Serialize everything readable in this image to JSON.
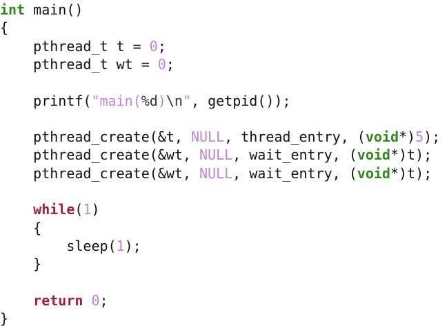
{
  "editor": {
    "lines": [
      [
        {
          "text": "int",
          "cls": "kw"
        },
        {
          "text": " main()",
          "cls": "plain"
        }
      ],
      [
        {
          "text": "{",
          "cls": "plain"
        }
      ],
      [
        {
          "text": "    pthread_t t = ",
          "cls": "plain"
        },
        {
          "text": "0",
          "cls": "lit"
        },
        {
          "text": ";",
          "cls": "plain"
        }
      ],
      [
        {
          "text": "    pthread_t wt = ",
          "cls": "plain"
        },
        {
          "text": "0",
          "cls": "lit"
        },
        {
          "text": ";",
          "cls": "plain"
        }
      ],
      [],
      [
        {
          "text": "    printf(",
          "cls": "plain"
        },
        {
          "text": "\"main(",
          "cls": "lit"
        },
        {
          "text": "%d",
          "cls": "fmt"
        },
        {
          "text": ")",
          "cls": "lit"
        },
        {
          "text": "\\n",
          "cls": "fmt"
        },
        {
          "text": "\"",
          "cls": "lit"
        },
        {
          "text": ", getpid());",
          "cls": "plain"
        }
      ],
      [],
      [
        {
          "text": "    pthread_create(&t, ",
          "cls": "plain"
        },
        {
          "text": "NULL",
          "cls": "lit"
        },
        {
          "text": ", thread_entry, (",
          "cls": "plain"
        },
        {
          "text": "void",
          "cls": "kw"
        },
        {
          "text": "*)",
          "cls": "plain"
        },
        {
          "text": "5",
          "cls": "lit"
        },
        {
          "text": ");",
          "cls": "plain"
        }
      ],
      [
        {
          "text": "    pthread_create(&wt, ",
          "cls": "plain"
        },
        {
          "text": "NULL",
          "cls": "lit"
        },
        {
          "text": ", wait_entry, (",
          "cls": "plain"
        },
        {
          "text": "void",
          "cls": "kw"
        },
        {
          "text": "*)t);",
          "cls": "plain"
        }
      ],
      [
        {
          "text": "    pthread_create(&wt, ",
          "cls": "plain"
        },
        {
          "text": "NULL",
          "cls": "lit"
        },
        {
          "text": ", wait_entry, (",
          "cls": "plain"
        },
        {
          "text": "void",
          "cls": "kw"
        },
        {
          "text": "*)t);",
          "cls": "plain"
        }
      ],
      [],
      [
        {
          "text": "    ",
          "cls": "plain"
        },
        {
          "text": "while",
          "cls": "ctl"
        },
        {
          "text": "(",
          "cls": "plain"
        },
        {
          "text": "1",
          "cls": "lit"
        },
        {
          "text": ")",
          "cls": "plain"
        }
      ],
      [
        {
          "text": "    {",
          "cls": "plain"
        }
      ],
      [
        {
          "text": "        sleep(",
          "cls": "plain"
        },
        {
          "text": "1",
          "cls": "lit"
        },
        {
          "text": ");",
          "cls": "plain"
        }
      ],
      [
        {
          "text": "    }",
          "cls": "plain"
        }
      ],
      [],
      [
        {
          "text": "    ",
          "cls": "plain"
        },
        {
          "text": "return",
          "cls": "ctl"
        },
        {
          "text": " ",
          "cls": "plain"
        },
        {
          "text": "0",
          "cls": "lit"
        },
        {
          "text": ";",
          "cls": "plain"
        }
      ],
      [
        {
          "text": "}",
          "cls": "plain"
        }
      ]
    ]
  },
  "colors": {
    "keyword": "#2e8b1a",
    "control": "#a3203a",
    "literal": "#c383d3",
    "text": "#111111",
    "background": "#ffffff"
  }
}
